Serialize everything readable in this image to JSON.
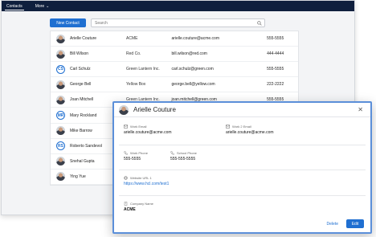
{
  "nav": {
    "tabs": [
      "Contacts",
      "More"
    ]
  },
  "toolbar": {
    "new_contact": "New Contact",
    "search_placeholder": "Search"
  },
  "contacts": [
    {
      "avatar": "photo",
      "initials": "",
      "name": "Arielle Couture",
      "company": "ACME",
      "email": "arielle.couture@acme.com",
      "phone": "555-5555"
    },
    {
      "avatar": "photo",
      "initials": "",
      "name": "Bill Wilson",
      "company": "Red Co.",
      "email": "bill.wilson@red.com",
      "phone": "444-4444"
    },
    {
      "avatar": "initials",
      "initials": "CS",
      "name": "Carl Schulz",
      "company": "Green Lantern Inc.",
      "email": "carl.schulz@green.com",
      "phone": "555-5555"
    },
    {
      "avatar": "photo",
      "initials": "",
      "name": "George Bell",
      "company": "Yellow Box",
      "email": "george.bell@yellow.com",
      "phone": "222-2222"
    },
    {
      "avatar": "photo",
      "initials": "",
      "name": "Joan Mitchell",
      "company": "Green Lantern Inc.",
      "email": "joan.mitchell@green.com",
      "phone": "555-5555"
    },
    {
      "avatar": "initials",
      "initials": "MR",
      "name": "Mary Rockland",
      "company": "",
      "email": "",
      "phone": ""
    },
    {
      "avatar": "photo",
      "initials": "",
      "name": "Mike Barrow",
      "company": "",
      "email": "",
      "phone": ""
    },
    {
      "avatar": "initials",
      "initials": "RS",
      "name": "Roberto Sandevol",
      "company": "",
      "email": "",
      "phone": ""
    },
    {
      "avatar": "photo",
      "initials": "",
      "name": "Snehal Gupta",
      "company": "",
      "email": "",
      "phone": ""
    },
    {
      "avatar": "photo",
      "initials": "",
      "name": "Ying Yue",
      "company": "",
      "email": "",
      "phone": ""
    }
  ],
  "detail": {
    "name": "Arielle Couture",
    "work_email_label": "Work Email",
    "work_email": "arielle.couture@acme.com",
    "work2_email_label": "Work 2 Email",
    "work2_email": "arielle.couture@acme.com",
    "work_phone_label": "Work Phone",
    "work_phone": "555-5555",
    "school_phone_label": "School Phone",
    "school_phone": "555-555-5555",
    "website_label": "Website URL 1",
    "website": "https://www.hcl.com/test1",
    "company_label": "Company Name",
    "company": "ACME",
    "delete": "Delete",
    "edit": "Edit"
  },
  "colors": {
    "accent": "#1f6fd1",
    "nav": "#0f1f3d",
    "panel_border": "#5b8fd9"
  },
  "icons": [
    "search-icon",
    "chevron-down-icon",
    "close-icon",
    "mail-icon",
    "phone-icon",
    "globe-icon",
    "building-icon"
  ]
}
